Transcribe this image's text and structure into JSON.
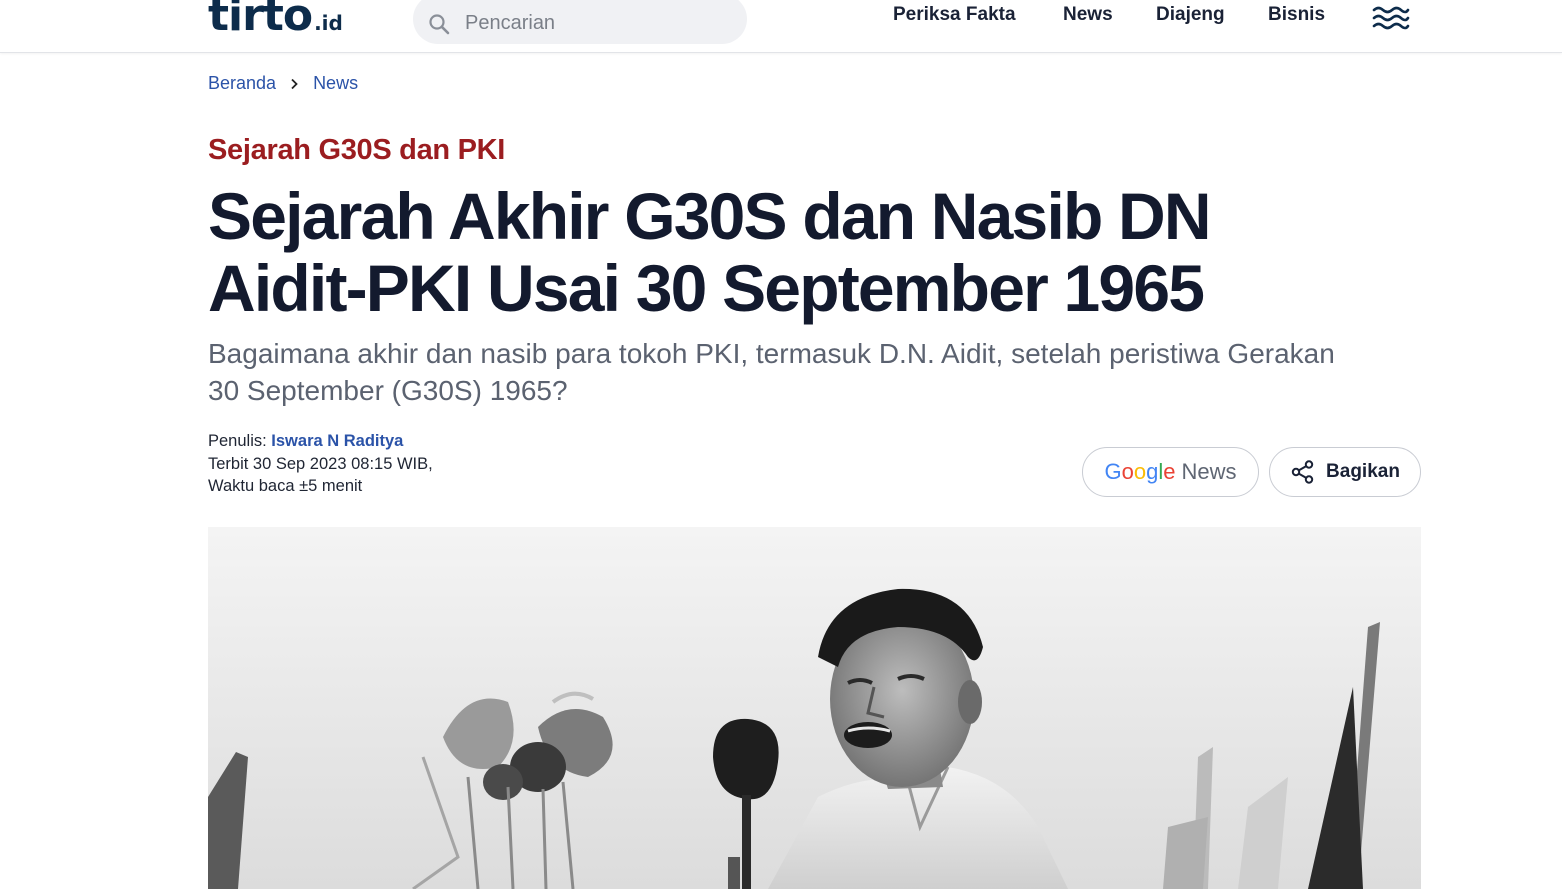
{
  "header": {
    "logo_main": "tirto",
    "logo_suffix": ".id",
    "search_placeholder": "Pencarian",
    "nav": [
      "Periksa Fakta",
      "News",
      "Diajeng",
      "Bisnis"
    ]
  },
  "breadcrumb": [
    "Beranda",
    "News"
  ],
  "article": {
    "kicker": "Sejarah G30S dan PKI",
    "title": "Sejarah Akhir G30S dan Nasib DN Aidit-PKI Usai 30 September 1965",
    "subtitle": "Bagaimana akhir dan nasib para tokoh PKI, termasuk D.N. Aidit, setelah peristiwa Gerakan 30 September (G30S) 1965?",
    "author_label": "Penulis:",
    "author_name": "Iswara N Raditya",
    "published": "Terbit 30 Sep 2023 08:15 WIB,",
    "read_time": "Waktu baca ±5 menit"
  },
  "actions": {
    "google_letters": [
      "G",
      "o",
      "o",
      "g",
      "l",
      "e"
    ],
    "google_news_word": "News",
    "share_label": "Bagikan"
  },
  "colors": {
    "brand_navy": "#0d2c4b",
    "kicker_red": "#9b1d20",
    "link_blue": "#2b53a8",
    "google_blue": "#4285F4",
    "google_red": "#EA4335",
    "google_yellow": "#FBBC05",
    "google_green": "#34A853"
  },
  "icons": [
    "search-icon",
    "menu-waves-icon",
    "chevron-right-icon",
    "share-icon"
  ]
}
